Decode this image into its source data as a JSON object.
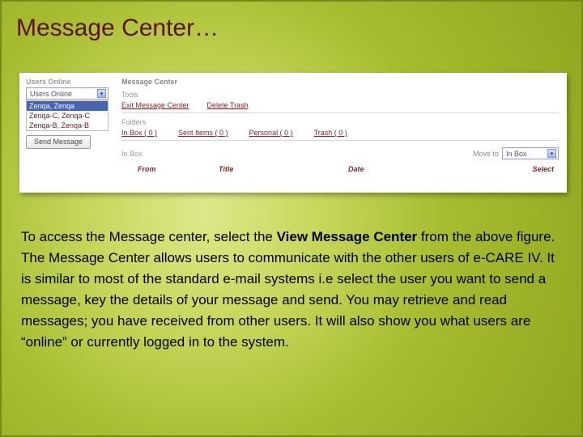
{
  "title": "Message Center…",
  "panel": {
    "sidebar": {
      "title": "Users Online",
      "select_value": "Users Online",
      "users": [
        "Zenqa, Zenqa",
        "Zenqa-C, Zenqa-C",
        "Zenqa-B, Zenqa-B"
      ],
      "send_button": "Send Message"
    },
    "main": {
      "title": "Message Center",
      "tools_label": "Tools",
      "tool_links": [
        "Exit Message Center",
        "Delete Trash"
      ],
      "folders_label": "Folders",
      "folder_links": [
        "In Box ( 0 )",
        "Sent Items ( 0 )",
        "Personal ( 0 )",
        "Trash ( 0 )"
      ],
      "inbox_label": "In Box",
      "moveto_label": "Move to",
      "moveto_value": "In Box",
      "headers": {
        "from": "From",
        "title": "Title",
        "date": "Date",
        "select": "Select"
      }
    }
  },
  "body": {
    "p1a": "To access the Message center, select the ",
    "p1b": "View Message Center",
    "p1c": " from the above figure.  The Message Center allows users to communicate with the other users of e-CARE IV.  It is similar to most of the standard e-mail systems i.e select the user you want to send a message, key the details of your message and send.  You may retrieve and read messages; you have received from other users. It will also show you what users are “online” or currently logged in to the system."
  }
}
